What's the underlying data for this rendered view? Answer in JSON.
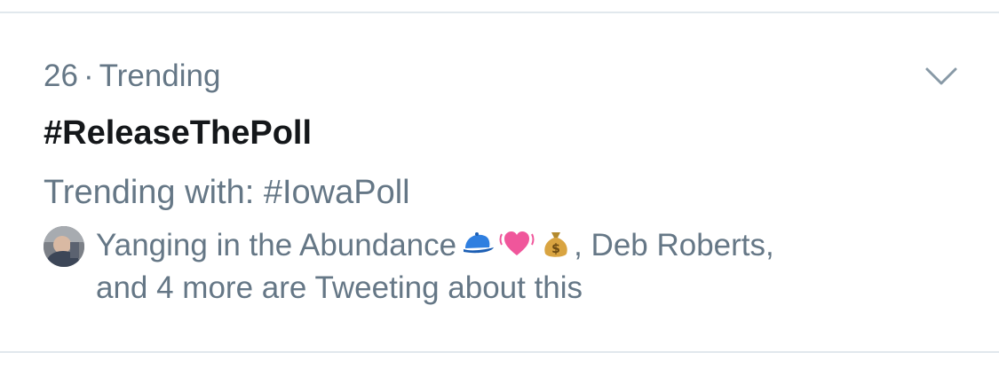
{
  "trend": {
    "rank": "26",
    "separator": "·",
    "category": "Trending",
    "hashtag": "#ReleaseThePoll",
    "trending_with": "Trending with: #IowaPoll",
    "social": {
      "user_one": "Yanging in the Abundance",
      "user_one_emojis": [
        "blue-cap-emoji",
        "beating-heart-emoji",
        "money-bag-emoji"
      ],
      "user_two_prefix": ", Deb Roberts,",
      "suffix": "and 4 more are Tweeting about this"
    }
  },
  "colors": {
    "secondary_text": "#657786",
    "primary_text": "#14171a",
    "divider": "#e1e8ed",
    "chevron": "#8899a6"
  },
  "icons": {
    "menu": "chevron-down-icon",
    "avatar": "user-avatar"
  }
}
